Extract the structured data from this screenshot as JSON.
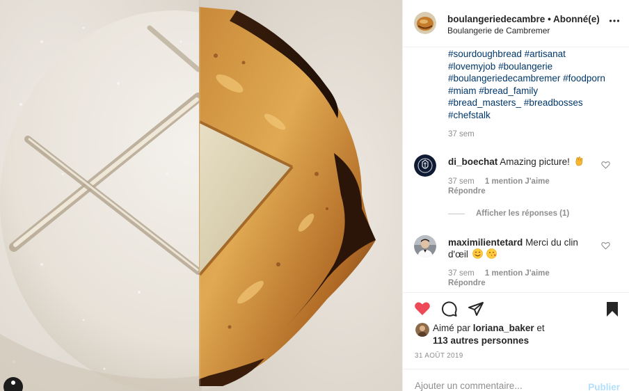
{
  "post": {
    "image_alt_icon": "person-icon"
  },
  "header": {
    "username": "boulangeriedecambre",
    "separator": "•",
    "follow_status": "Abonné(e)",
    "location": "Boulangerie de Cambremer",
    "more_icon": "more-horizontal-icon",
    "more_label": "•••"
  },
  "caption": {
    "hashtags": [
      "#sourdoughbread",
      "#artisanat",
      "#lovemyjob",
      "#boulangerie",
      "#boulangeriedecambremer",
      "#foodporn",
      "#miam",
      "#bread_family",
      "#bread_masters_",
      "#breadbosses",
      "#chefstalk"
    ],
    "time": "37 sem"
  },
  "comments": [
    {
      "username": "di_boechat",
      "text": "Amazing picture!",
      "emoji": "ok-hand-emoji",
      "time": "37 sem",
      "likes": "1 mention J'aime",
      "reply": "Répondre",
      "view_replies": "Afficher les réponses (1)"
    },
    {
      "username": "maximilientetard",
      "text": "Merci du clin d'œil",
      "emojis": [
        "smile-emoji",
        "wink-kiss-emoji"
      ],
      "time": "37 sem",
      "likes": "1 mention J'aime",
      "reply": "Répondre"
    }
  ],
  "actions": {
    "like_icon": "heart-filled-icon",
    "comment_icon": "comment-icon",
    "share_icon": "paper-plane-icon",
    "save_icon": "bookmark-filled-icon",
    "like_color": "#ed4956"
  },
  "likes": {
    "prefix": "Aimé par",
    "user": "loriana_baker",
    "and": "et",
    "others": "113 autres personnes"
  },
  "date": "31 AOÛT 2019",
  "add_comment": {
    "placeholder": "Ajouter un commentaire...",
    "publish_label": "Publier",
    "publish_color": "#b2dffc"
  }
}
